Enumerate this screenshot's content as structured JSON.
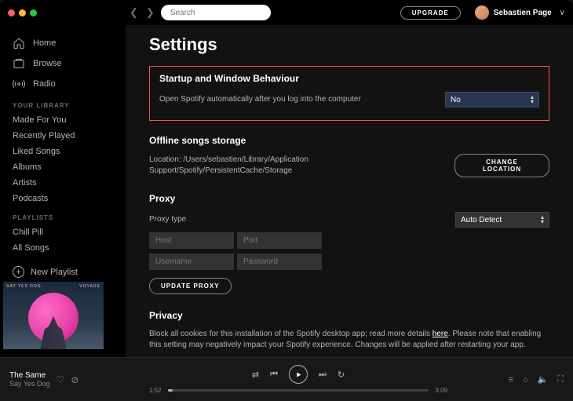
{
  "topbar": {
    "search_placeholder": "Search",
    "upgrade_label": "UPGRADE",
    "username": "Sebastien Page"
  },
  "sidebar": {
    "home": "Home",
    "browse": "Browse",
    "radio": "Radio",
    "library_title": "YOUR LIBRARY",
    "library": [
      "Made For You",
      "Recently Played",
      "Liked Songs",
      "Albums",
      "Artists",
      "Podcasts"
    ],
    "playlists_title": "PLAYLISTS",
    "playlists": [
      "Chill Pill",
      "All Songs"
    ],
    "new_playlist": "New Playlist",
    "album_art": {
      "top_left": "SAY YES DOG",
      "top_right": "VOYAGE"
    }
  },
  "settings": {
    "title": "Settings",
    "startup": {
      "heading": "Startup and Window Behaviour",
      "desc": "Open Spotify automatically after you log into the computer",
      "value": "No"
    },
    "offline": {
      "heading": "Offline songs storage",
      "location_label": "Location: ",
      "location_value": "/Users/sebastien/Library/Application Support/Spotify/PersistentCache/Storage",
      "change_btn": "CHANGE LOCATION"
    },
    "proxy": {
      "heading": "Proxy",
      "type_label": "Proxy type",
      "type_value": "Auto Detect",
      "host_ph": "Host",
      "port_ph": "Port",
      "user_ph": "Username",
      "pass_ph": "Password",
      "update_btn": "UPDATE PROXY"
    },
    "privacy": {
      "heading": "Privacy",
      "desc_a": "Block all cookies for this installation of the Spotify desktop app; read more details ",
      "desc_link": "here",
      "desc_b": ". Please note that enabling this setting may negatively impact your Spotify experience. Changes will be applied after restarting your app."
    }
  },
  "player": {
    "track": "The Same",
    "artist": "Say Yes Dog",
    "elapsed": "1:52",
    "total": "3:09"
  }
}
